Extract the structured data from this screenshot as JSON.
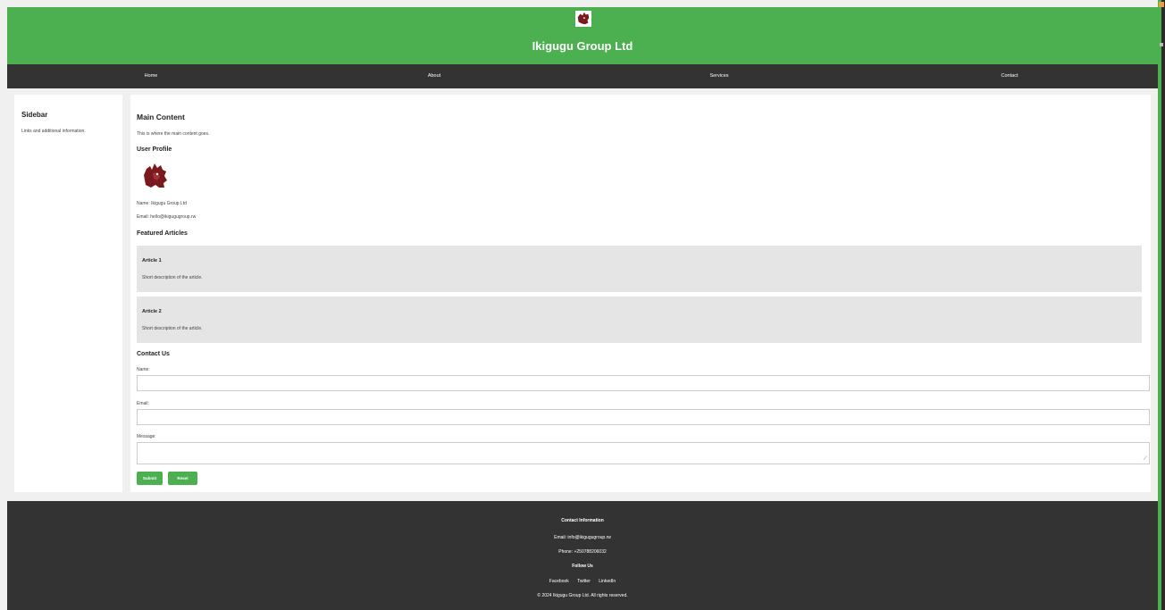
{
  "header": {
    "title": "Ikigugu Group Ltd",
    "logo_icon": "lion-head-logo"
  },
  "nav": {
    "items": [
      {
        "label": "Home"
      },
      {
        "label": "About"
      },
      {
        "label": "Services"
      },
      {
        "label": "Contact"
      }
    ]
  },
  "sidebar": {
    "title": "Sidebar",
    "text": "Links and additional information."
  },
  "main": {
    "title": "Main Content",
    "intro": "This is where the main content goes.",
    "profile": {
      "heading": "User Profile",
      "avatar_icon": "lion-head-logo",
      "name": "Name: Ikigugu Group Ltd",
      "email": "Email: hello@ikigugugroup.rw"
    },
    "articles": {
      "heading": "Featured Articles",
      "items": [
        {
          "title": "Article 1",
          "description": "Short description of the article."
        },
        {
          "title": "Article 2",
          "description": "Short description of the article."
        }
      ]
    },
    "contact": {
      "heading": "Contact Us",
      "name_label": "Name:",
      "name_value": "",
      "email_label": "Email:",
      "email_value": "",
      "message_label": "Message:",
      "message_value": "",
      "submit_label": "Submit",
      "reset_label": "Reset"
    }
  },
  "footer": {
    "contact_heading": "Contact Information",
    "email": "Email: info@ikigugugroup.rw",
    "phone": "Phone: +250788206032",
    "follow_heading": "Follow Us",
    "social": [
      "Facebook",
      "Twitter",
      "LinkedIn"
    ],
    "copyright": "© 2024 Ikigugu Group Ltd. All rights reserved."
  },
  "colors": {
    "brand_green": "#4caf50",
    "nav_dark": "#333333",
    "article_bg": "#e5e5e5",
    "logo_maroon": "#7a1a1f"
  }
}
